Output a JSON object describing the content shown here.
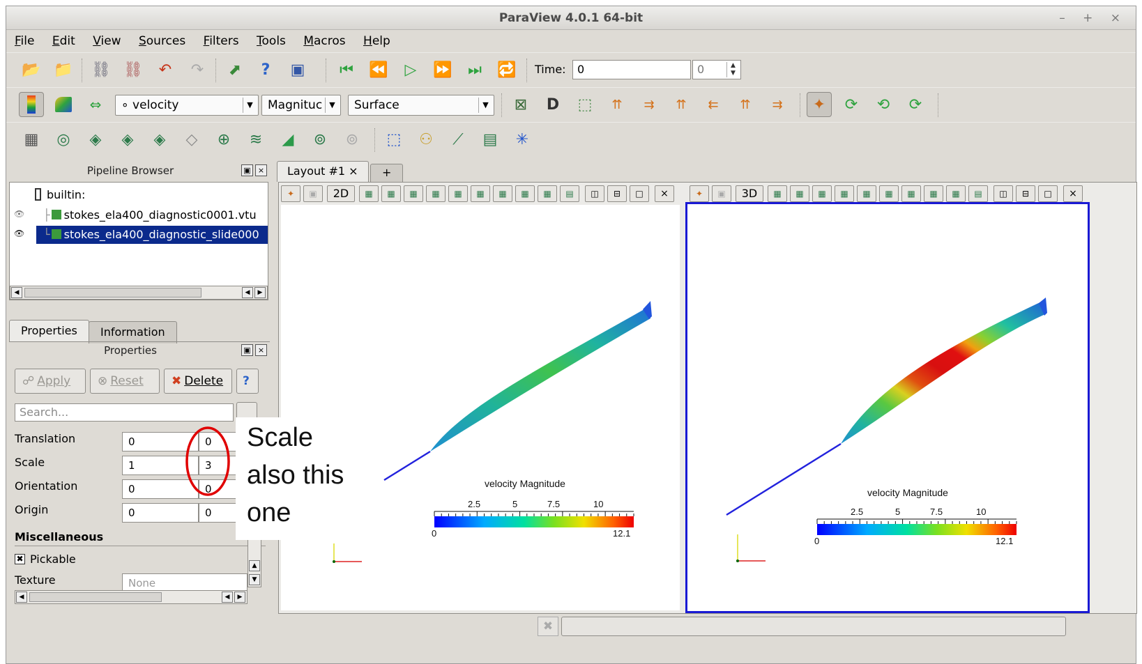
{
  "window": {
    "title": "ParaView 4.0.1 64-bit",
    "controls": "– + ×"
  },
  "menu": [
    {
      "u": "F",
      "rest": "ile"
    },
    {
      "u": "E",
      "rest": "dit"
    },
    {
      "u": "V",
      "rest": "iew"
    },
    {
      "u": "S",
      "rest": "ources"
    },
    {
      "u": "F",
      "rest": "ilters"
    },
    {
      "u": "T",
      "rest": "ools"
    },
    {
      "u": "M",
      "rest": "acros"
    },
    {
      "u": "H",
      "rest": "elp"
    }
  ],
  "toolbar": {
    "time_label": "Time:",
    "time_value": "0",
    "time_step": "0",
    "array_combo": "∘ velocity",
    "component_combo": "Magnituc",
    "representation_combo": "Surface"
  },
  "pipeline": {
    "title": "Pipeline Browser",
    "root": "builtin:",
    "items": [
      {
        "label": "stokes_ela400_diagnostic0001.vtu",
        "selected": false
      },
      {
        "label": "stokes_ela400_diagnostic_slide000",
        "selected": true
      }
    ]
  },
  "prop_tabs": [
    "Properties",
    "Information"
  ],
  "properties": {
    "title": "Properties",
    "apply": "Apply",
    "reset": "Reset",
    "delete": "Delete",
    "search_placeholder": "Search...",
    "rows": [
      {
        "label": "Translation",
        "v1": "0",
        "v2": "0"
      },
      {
        "label": "Scale",
        "v1": "1",
        "v2": "3"
      },
      {
        "label": "Orientation",
        "v1": "0",
        "v2": "0"
      },
      {
        "label": "Origin",
        "v1": "0",
        "v2": "0"
      }
    ],
    "misc_heading": "Miscellaneous",
    "pickable_label": "Pickable",
    "texture_label": "Texture",
    "texture_value": "None"
  },
  "layout_tabs": [
    "Layout #1 ×",
    "+"
  ],
  "views": [
    {
      "mode": "2D",
      "legend_title": "velocity Magnitude",
      "ticks": [
        "2.5",
        "5",
        "7.5",
        "10"
      ],
      "min": "0",
      "max": "12.1"
    },
    {
      "mode": "3D",
      "legend_title": "velocity Magnitude",
      "ticks": [
        "2.5",
        "5",
        "7.5",
        "10"
      ],
      "min": "0",
      "max": "12.1"
    }
  ],
  "callout": {
    "lines": [
      "Scale",
      "also this",
      "one"
    ]
  },
  "colors": {
    "selection": "#0b2a8c",
    "annotation": "#e00000",
    "active_view_border": "#1a1ad4"
  }
}
